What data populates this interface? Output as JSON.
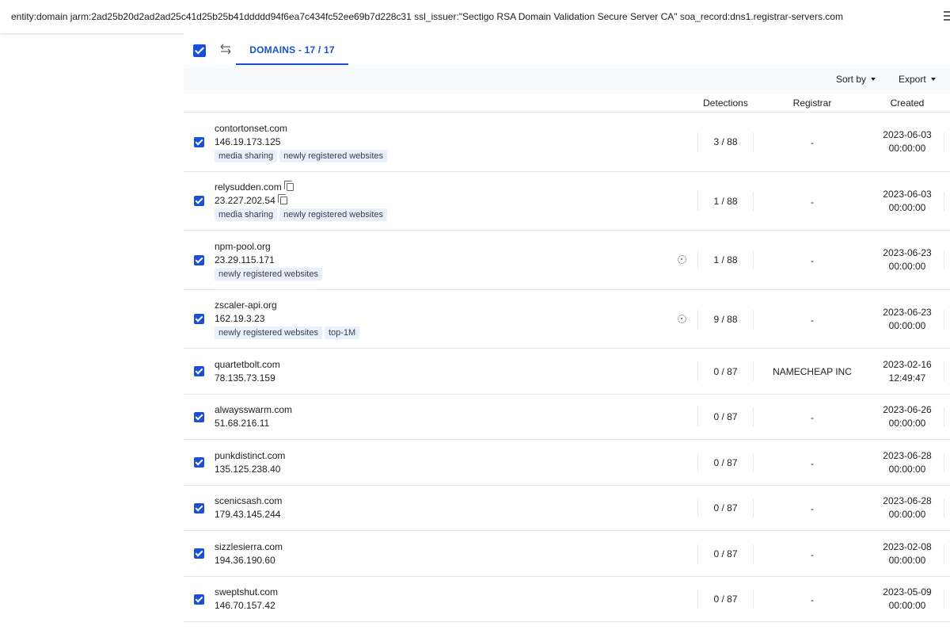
{
  "search": {
    "query": "entity:domain jarm:2ad25b20d2ad2ad25c41d25b25b41ddddd94f6ea7c434fc52ee69b7d228c31 ssl_issuer:\"Sectigo RSA Domain Validation Secure Server CA\" soa_record:dns1.registrar-servers.com"
  },
  "tabs": {
    "domains_label": "DOMAINS - 17 / 17"
  },
  "toolbar": {
    "sort_label": "Sort by",
    "export_label": "Export"
  },
  "columns": {
    "detections": "Detections",
    "registrar": "Registrar",
    "created": "Created"
  },
  "colors": {
    "accent": "#1a4fd6",
    "tag_bg": "#e8f0fe"
  },
  "rows": [
    {
      "domain": "contortonset.com",
      "ip": "146.19.173.125",
      "tags": [
        "media sharing",
        "newly registered websites"
      ],
      "copy_icons": false,
      "threat_icon": false,
      "detections": "3 / 88",
      "registrar": "-",
      "created_date": "2023-06-03",
      "created_time": "00:00:00"
    },
    {
      "domain": "relysudden.com",
      "ip": "23.227.202.54",
      "tags": [
        "media sharing",
        "newly registered websites"
      ],
      "copy_icons": true,
      "threat_icon": false,
      "detections": "1 / 88",
      "registrar": "-",
      "created_date": "2023-06-03",
      "created_time": "00:00:00"
    },
    {
      "domain": "npm-pool.org",
      "ip": "23.29.115.171",
      "tags": [
        "newly registered websites"
      ],
      "copy_icons": false,
      "threat_icon": true,
      "detections": "1 / 88",
      "registrar": "-",
      "created_date": "2023-06-23",
      "created_time": "00:00:00"
    },
    {
      "domain": "zscaler-api.org",
      "ip": "162.19.3.23",
      "tags": [
        "newly registered websites",
        "top-1M"
      ],
      "copy_icons": false,
      "threat_icon": true,
      "detections": "9 / 88",
      "registrar": "-",
      "created_date": "2023-06-23",
      "created_time": "00:00:00"
    },
    {
      "domain": "quartetbolt.com",
      "ip": "78.135.73.159",
      "tags": [],
      "copy_icons": false,
      "threat_icon": false,
      "detections": "0 / 87",
      "registrar": "NAMECHEAP INC",
      "created_date": "2023-02-16",
      "created_time": "12:49:47"
    },
    {
      "domain": "alwaysswarm.com",
      "ip": "51.68.216.11",
      "tags": [],
      "copy_icons": false,
      "threat_icon": false,
      "detections": "0 / 87",
      "registrar": "-",
      "created_date": "2023-06-26",
      "created_time": "00:00:00"
    },
    {
      "domain": "punkdistinct.com",
      "ip": "135.125.238.40",
      "tags": [],
      "copy_icons": false,
      "threat_icon": false,
      "detections": "0 / 87",
      "registrar": "-",
      "created_date": "2023-06-28",
      "created_time": "00:00:00"
    },
    {
      "domain": "scenicsash.com",
      "ip": "179.43.145.244",
      "tags": [],
      "copy_icons": false,
      "threat_icon": false,
      "detections": "0 / 87",
      "registrar": "-",
      "created_date": "2023-06-28",
      "created_time": "00:00:00"
    },
    {
      "domain": "sizzlesierra.com",
      "ip": "194.36.190.60",
      "tags": [],
      "copy_icons": false,
      "threat_icon": false,
      "detections": "0 / 87",
      "registrar": "-",
      "created_date": "2023-02-08",
      "created_time": "00:00:00"
    },
    {
      "domain": "sweptshut.com",
      "ip": "146.70.157.42",
      "tags": [],
      "copy_icons": false,
      "threat_icon": false,
      "detections": "0 / 87",
      "registrar": "-",
      "created_date": "2023-05-09",
      "created_time": "00:00:00"
    }
  ]
}
